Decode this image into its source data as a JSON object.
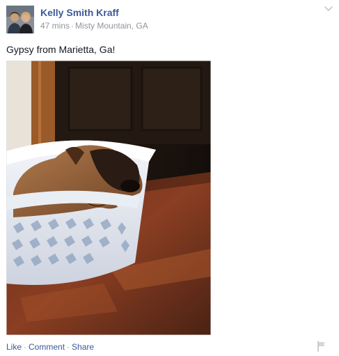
{
  "post": {
    "author": "Kelly Smith Kraff",
    "time": "47 mins",
    "separator": "·",
    "location": "Misty Mountain, GA",
    "text": "Gypsy from Marietta, Ga!"
  },
  "actions": {
    "like": "Like",
    "comment": "Comment",
    "share": "Share",
    "dot": "·"
  },
  "icons": {
    "menu": "chevron-down-icon",
    "report": "flag-icon"
  },
  "colors": {
    "link": "#3b5998",
    "meta": "#90949c",
    "text": "#141823"
  }
}
